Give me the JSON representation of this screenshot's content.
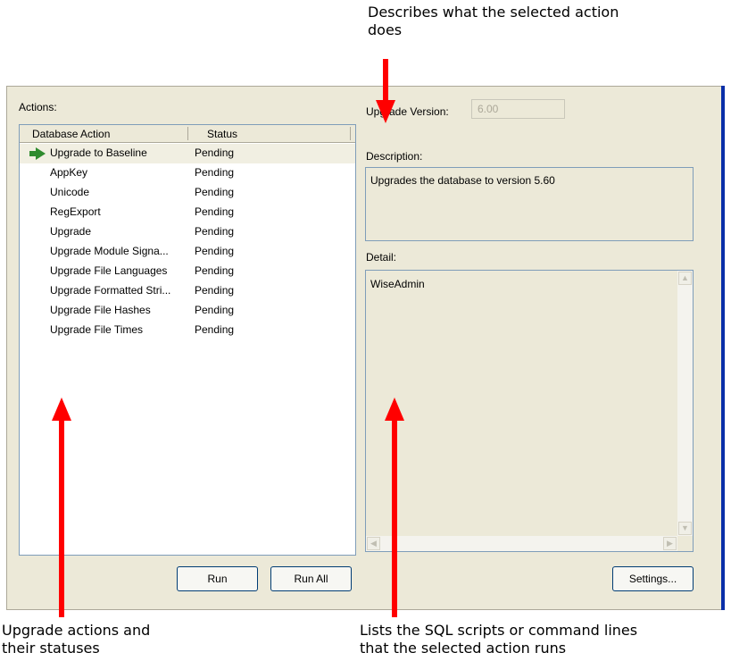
{
  "callouts": {
    "top": [
      "Describes what the selected action",
      "does"
    ],
    "bottom_left": [
      "Upgrade actions and",
      "their statuses"
    ],
    "bottom_right": [
      "Lists the SQL scripts or command lines",
      "that the selected action runs"
    ]
  },
  "actions": {
    "label": "Actions:",
    "columns": [
      "Database Action",
      "Status"
    ],
    "rows": [
      {
        "action": "Upgrade to Baseline",
        "status": "Pending",
        "current": true
      },
      {
        "action": "AppKey",
        "status": "Pending"
      },
      {
        "action": "Unicode",
        "status": "Pending"
      },
      {
        "action": "RegExport",
        "status": "Pending"
      },
      {
        "action": "Upgrade",
        "status": "Pending"
      },
      {
        "action": "Upgrade Module Signa...",
        "status": "Pending"
      },
      {
        "action": "Upgrade File Languages",
        "status": "Pending"
      },
      {
        "action": "Upgrade Formatted Stri...",
        "status": "Pending"
      },
      {
        "action": "Upgrade File Hashes",
        "status": "Pending"
      },
      {
        "action": "Upgrade File Times",
        "status": "Pending"
      }
    ],
    "run_label": "Run",
    "run_all_label": "Run All"
  },
  "upgrade_version": {
    "label": "Upgrade Version:",
    "value": "6.00"
  },
  "description": {
    "label": "Description:",
    "text": "Upgrades the database to version 5.60"
  },
  "detail": {
    "label": "Detail:",
    "text": "WiseAdmin"
  },
  "settings_label": "Settings...",
  "colors": {
    "panel": "#ece9d8",
    "arrow": "#ff0000",
    "accent": "#0a2fa8",
    "current_icon": "#2e8b2e"
  }
}
